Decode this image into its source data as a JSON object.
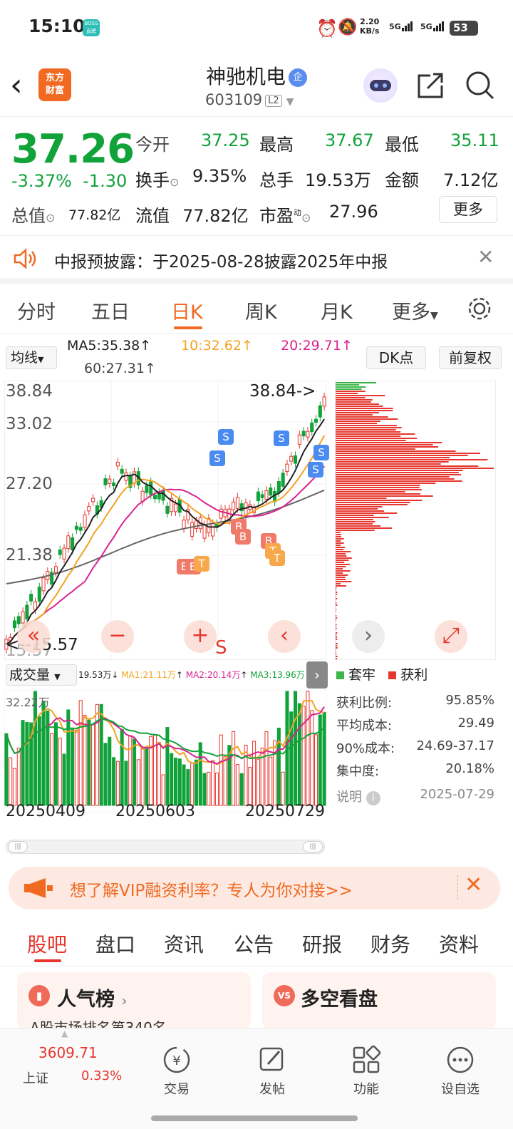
{
  "status_bar": {
    "time": "15:10",
    "boss_badge": "BOSS直聘",
    "net_speed": "2.20",
    "net_unit": "KB/s",
    "sig1": "5G",
    "sig2": "5G",
    "battery": "53"
  },
  "header": {
    "logo_line1": "东方",
    "logo_line2": "财富",
    "stock_name": "神驰机电",
    "qi_badge": "企",
    "stock_code": "603109",
    "l2_badge": "L2"
  },
  "quote": {
    "price": "37.26",
    "change_pct": "-3.37%",
    "change_abs": "-1.30",
    "open_label": "今开",
    "open": "37.25",
    "high_label": "最高",
    "high": "37.67",
    "low_label": "最低",
    "low": "35.11",
    "turnover_label": "换手",
    "turnover": "9.35%",
    "volume_label": "总手",
    "volume": "19.53万",
    "amount_label": "金额",
    "amount": "7.12亿",
    "total_mv_label": "总值",
    "total_mv": "77.82亿",
    "float_mv_label": "流值",
    "float_mv": "77.82亿",
    "pe_label": "市盈",
    "pe_sup": "动",
    "pe": "27.96",
    "more_label": "更多"
  },
  "notice": {
    "text": "中报预披露：于2025-08-28披露2025年中报"
  },
  "period_tabs": {
    "t1": "分时",
    "t2": "五日",
    "t3": "日K",
    "t4": "周K",
    "t5": "月K",
    "t6": "更多"
  },
  "chart": {
    "ma_selector": "均线",
    "ma5": "MA5:35.38",
    "ma10": "10:32.62",
    "ma20": "20:29.71",
    "ma60": "60:27.31",
    "dk_button": "DK点",
    "adjust_button": "前复权",
    "y1": "38.84",
    "y2": "33.02",
    "y3": "27.20",
    "y4": "21.38",
    "y5": "15.57",
    "max_marker": "38.84->",
    "min_marker": "<--15.57",
    "ma5_color": "#222222",
    "ma10_color": "#f2a321",
    "ma20_color": "#d8238f",
    "ma60_color": "#666666",
    "volume_selector": "成交量",
    "vol_value": "19.53万",
    "vol_ma1": "MA1:21.11万",
    "vol_ma2": "MA2:20.14万",
    "vol_ma3": "MA3:13.96万",
    "vol_max": "32.22万",
    "d1": "20250409",
    "d2": "20250603",
    "d3": "20250729",
    "s_mark": "S"
  },
  "chip": {
    "legend_trapped": "套牢",
    "legend_profit": "获利",
    "profit_ratio_label": "获利比例:",
    "profit_ratio": "95.85%",
    "avg_cost_label": "平均成本:",
    "avg_cost": "29.49",
    "cost90_label": "90%成本:",
    "cost90": "24.69-37.17",
    "concentration_label": "集中度:",
    "concentration": "20.18%",
    "explain_label": "说明",
    "date": "2025-07-29"
  },
  "vip": {
    "text": "想了解VIP融资利率？专人为你对接>>"
  },
  "bottom_tabs": {
    "t1": "股吧",
    "t2": "盘口",
    "t3": "资讯",
    "t4": "公告",
    "t5": "研报",
    "t6": "财务",
    "t7": "资料"
  },
  "cards": {
    "c1": "人气榜",
    "c1_sub": "A股市场排名第340名",
    "c2": "多空看盘"
  },
  "nav": {
    "index_value": "3609.71",
    "index_name": "上证",
    "index_change": "0.33%",
    "trade": "交易",
    "post": "发帖",
    "func": "功能",
    "watch": "设自选"
  }
}
